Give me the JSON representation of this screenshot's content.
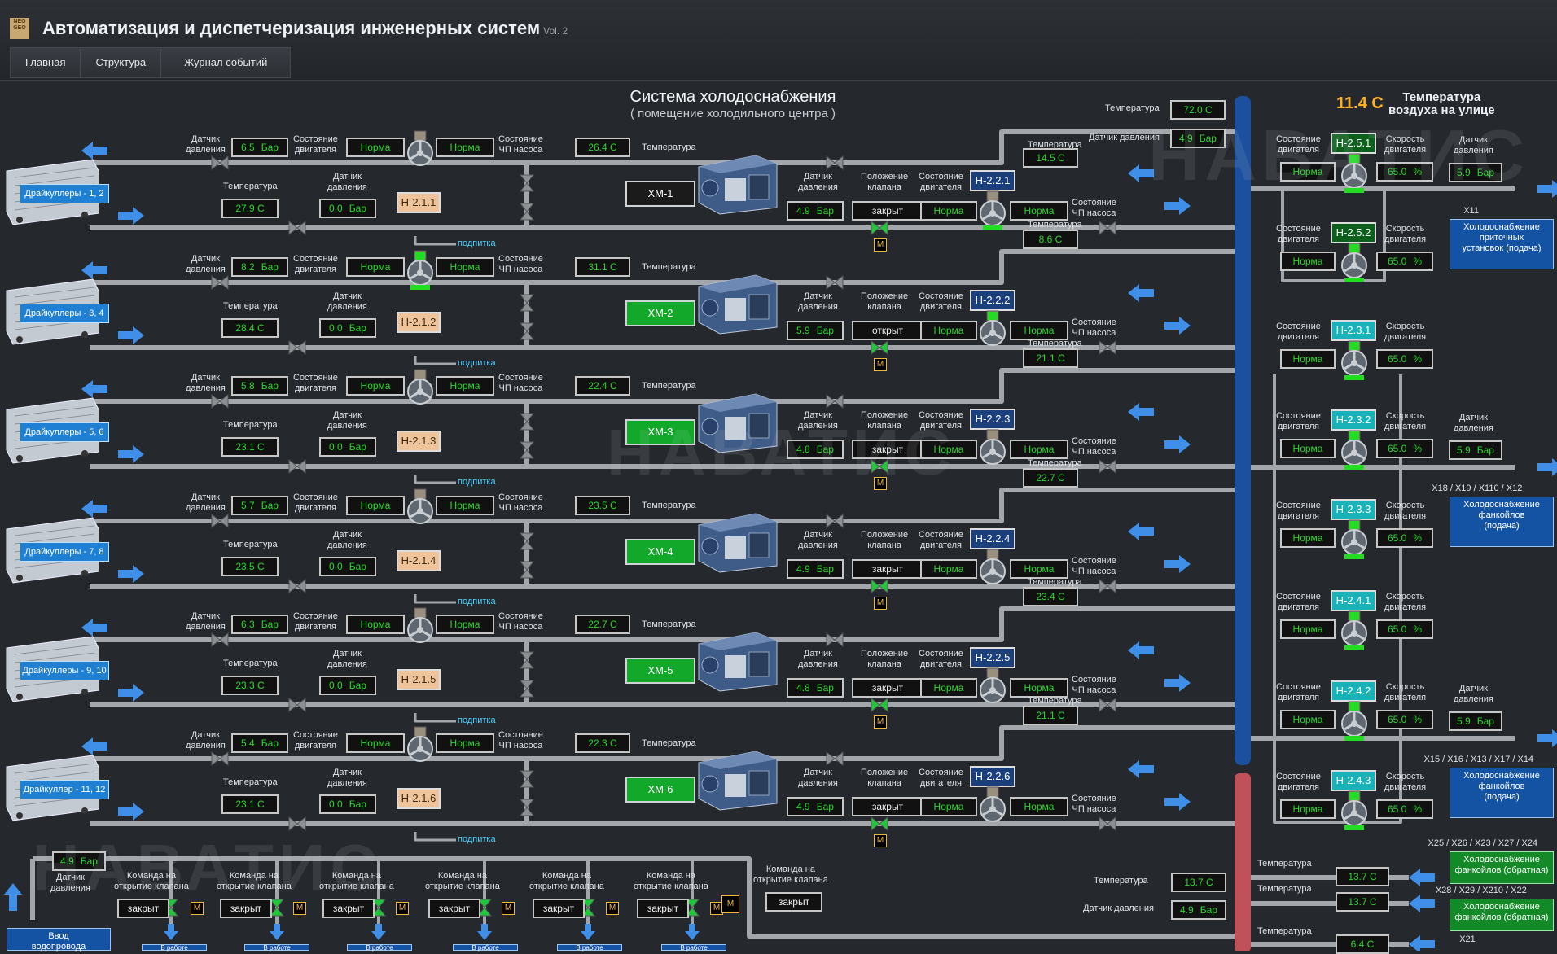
{
  "app": {
    "logo_text": "NEO GEO",
    "title": "Автоматизация и диспетчеризация инженерных систем",
    "version": "Vol. 2"
  },
  "tabs": [
    "Главная",
    "Структура",
    "Журнал событий"
  ],
  "system": {
    "title": "Система холодоснабжения",
    "subtitle": "( помещение холодильного центра )"
  },
  "watermark": "НАВАТИС",
  "colors": {
    "norm_text": "#2dd52d",
    "pipe": "#a3a6aa",
    "supply_header": "#1c4f9e",
    "return_header": "#c0505a",
    "arrow": "#3f8ee8"
  },
  "labels": {
    "pressure_sensor": [
      "Датчик",
      "давления"
    ],
    "motor_state": [
      "Состояние",
      "двигателя"
    ],
    "vfd_state": [
      "Состояние",
      "ЧП насоса"
    ],
    "temperature": "Температура",
    "valve_position": [
      "Положение",
      "клапана"
    ],
    "speed": [
      "Скорость",
      "двигателя"
    ],
    "makeup": "подпитка",
    "valve_command": [
      "Команда на",
      "открытие клапана"
    ],
    "norm": "Норма",
    "bar": "Бар",
    "percent": "%",
    "motor_tag": "M",
    "pressure_sensor_inline": "Датчик давления"
  },
  "outside": {
    "value": "11.4 C",
    "label": [
      "Температура",
      "воздуха на улице"
    ]
  },
  "rows": [
    {
      "dc": "Драйкуллеры - 1, 2",
      "p1": "6.5",
      "t1": "27.9 C",
      "p2": "0.0",
      "pump": "Н-2.1.1",
      "tchw": "26.4 C",
      "xm": "ХМ-1",
      "xm_on": false,
      "p3": "4.9",
      "valve": "закрыт",
      "pump2": "Н-2.2.1",
      "t2": "14.5 C"
    },
    {
      "dc": "Драйкуллеры - 3, 4",
      "p1": "8.2",
      "t1": "28.4 C",
      "p2": "0.0",
      "pump": "Н-2.1.2",
      "tchw": "31.1 C",
      "xm": "ХМ-2",
      "xm_on": true,
      "p3": "5.9",
      "valve": "открыт",
      "pump2": "Н-2.2.2",
      "t2": "8.6 C"
    },
    {
      "dc": "Драйкуллеры - 5, 6",
      "p1": "5.8",
      "t1": "23.1 C",
      "p2": "0.0",
      "pump": "Н-2.1.3",
      "tchw": "22.4 C",
      "xm": "ХМ-3",
      "xm_on": true,
      "p3": "4.8",
      "valve": "закрыт",
      "pump2": "Н-2.2.3",
      "t2": "21.1 C"
    },
    {
      "dc": "Драйкуллеры - 7, 8",
      "p1": "5.7",
      "t1": "23.5 C",
      "p2": "0.0",
      "pump": "Н-2.1.4",
      "tchw": "23.5 C",
      "xm": "ХМ-4",
      "xm_on": true,
      "p3": "4.9",
      "valve": "закрыт",
      "pump2": "Н-2.2.4",
      "t2": "22.7 C"
    },
    {
      "dc": "Драйкуллеры - 9, 10",
      "p1": "6.3",
      "t1": "23.3 C",
      "p2": "0.0",
      "pump": "Н-2.1.5",
      "tchw": "22.7 C",
      "xm": "ХМ-5",
      "xm_on": true,
      "p3": "4.8",
      "valve": "закрыт",
      "pump2": "Н-2.2.5",
      "t2": "23.4 C"
    },
    {
      "dc": "Драйкуллер - 11, 12",
      "p1": "5.4",
      "t1": "23.1 C",
      "p2": "0.0",
      "pump": "Н-2.1.6",
      "tchw": "22.3 C",
      "xm": "ХМ-6",
      "xm_on": true,
      "p3": "4.9",
      "valve": "закрыт",
      "pump2": "Н-2.2.6",
      "t2": "21.1 C"
    }
  ],
  "header_top": {
    "temp": "72.0 C",
    "pressure": "4.9"
  },
  "right_pumps": [
    {
      "id": "Н-2.5.1",
      "speed": "65.0",
      "style": "green"
    },
    {
      "id": "Н-2.5.2",
      "speed": "65.0",
      "style": "green"
    },
    {
      "id": "Н-2.3.1",
      "speed": "65.0",
      "style": "cyan"
    },
    {
      "id": "Н-2.3.2",
      "speed": "65.0",
      "style": "cyan"
    },
    {
      "id": "Н-2.3.3",
      "speed": "65.0",
      "style": "cyan"
    },
    {
      "id": "Н-2.4.1",
      "speed": "65.0",
      "style": "cyan"
    },
    {
      "id": "Н-2.4.2",
      "speed": "65.0",
      "style": "cyan"
    },
    {
      "id": "Н-2.4.3",
      "speed": "65.0",
      "style": "cyan"
    }
  ],
  "right_pressures": [
    "5.9",
    "5.9",
    "5.9"
  ],
  "consumers": [
    {
      "code": "X11",
      "text": [
        "Холодоснабжение",
        "приточных",
        "установок (подача)"
      ]
    },
    {
      "code": "X18 / X19 / X110 / X12",
      "text": [
        "Холодоснабжение",
        "фанкойлов",
        "(подача)"
      ]
    },
    {
      "code": "X15 / X16 / X13 / X17 / X14",
      "text": [
        "Холодоснабжение",
        "фанкойлов",
        "(подача)"
      ]
    },
    {
      "code": "X25 / X26 / X23 / X27 / X24",
      "text": [
        "Холодоснабжение",
        "фанкойлов (обратная)"
      ]
    },
    {
      "code": "X28 / X29 / X210 / X22",
      "text": [
        "Холодоснабжение",
        "фанкойлов (обратная)"
      ]
    },
    {
      "code": "X21",
      "text": []
    }
  ],
  "return_temps": [
    "13.7 C",
    "13.7 C",
    "6.4 C"
  ],
  "return_main": {
    "temp": "13.7 C",
    "pressure": "4.9"
  },
  "bottom": {
    "pressure": "4.9",
    "valve_states": [
      "закрыт",
      "закрыт",
      "закрыт",
      "закрыт",
      "закрыт",
      "закрыт"
    ],
    "extra_valve": "закрыт",
    "inlet": [
      "Ввод",
      "водопровода"
    ],
    "status_label": "В работе"
  }
}
